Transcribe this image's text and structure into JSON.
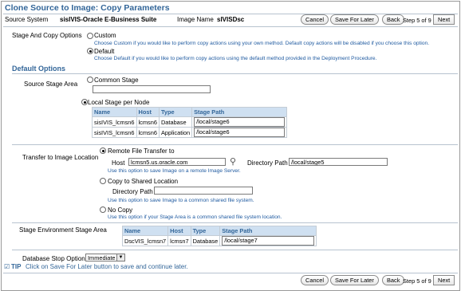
{
  "header": {
    "title": "Clone Source to Image: Copy Parameters",
    "source_system_label": "Source System",
    "source_system_value": "sisIVIS-Oracle E-Business Suite",
    "image_name_label": "Image Name",
    "image_name_value": "sIVISDsc"
  },
  "nav": {
    "cancel": "Cancel",
    "save_for_later": "Save For Later",
    "back": "Back",
    "step": "Step 5 of 9",
    "next": "Next"
  },
  "stage_copy": {
    "label": "Stage And Copy Options",
    "custom_label": "Custom",
    "custom_help": "Choose Custom if you would like to perform copy actions using your own method. Default copy actions will be disabled if you choose this option.",
    "default_label": "Default",
    "default_help": "Choose Default if you would like to perform copy actions using the default method provided in the Deployment Procedure."
  },
  "default_options": {
    "heading": "Default Options",
    "source_stage_area_label": "Source Stage Area",
    "common_stage_label": "Common Stage",
    "common_stage_value": "",
    "local_stage_label": "Local Stage per Node",
    "table_headers": [
      "Name",
      "Host",
      "Type",
      "Stage Path"
    ],
    "rows": [
      {
        "name": "sisIVIS_lcmsn6",
        "host": "lcmsn6",
        "type": "Database",
        "path": "/local/stage6"
      },
      {
        "name": "sisIVIS_lcmsn6",
        "host": "lcmsn6",
        "type": "Application",
        "path": "/local/stage6"
      }
    ]
  },
  "transfer": {
    "label": "Transfer to Image Location",
    "remote_label": "Remote File Transfer to",
    "host_label": "Host",
    "host_value": "lcmsn5.us.oracle.com",
    "dir_label": "Directory Path",
    "dir_value": "/local/stage5",
    "remote_help": "Use this option to save Image on a remote Image Server.",
    "shared_label": "Copy to Shared Location",
    "shared_dir_label": "Directory Path",
    "shared_dir_value": "",
    "shared_help": "Use this option to save Image to a common shared file system.",
    "nocopy_label": "No Copy",
    "nocopy_help": "Use this option if your Stage Area is a common shared file system location."
  },
  "env_stage": {
    "label": "Stage Environment Stage Area",
    "table_headers": [
      "Name",
      "Host",
      "Type",
      "Stage Path"
    ],
    "rows": [
      {
        "name": "DscVIS_lcmsn7",
        "host": "lcmsn7",
        "type": "Database",
        "path": "/local/stage7"
      }
    ]
  },
  "db_stop": {
    "label": "Database Stop Option",
    "value": "Immediate"
  },
  "tip": {
    "label": "TIP",
    "text": "Click on Save For Later button to save and continue later."
  },
  "colors": {
    "accent": "#336699",
    "header_bg": "#cfe0f1"
  }
}
